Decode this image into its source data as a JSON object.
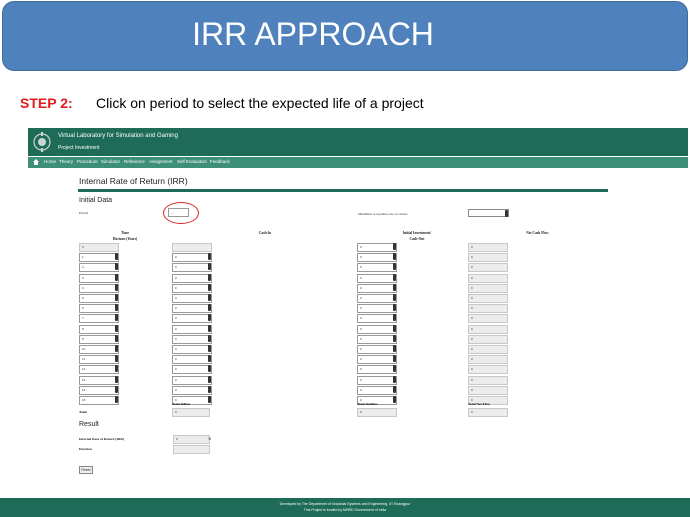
{
  "slide": {
    "title": "IRR APPROACH",
    "step_label": "STEP 2:",
    "step_text": "Click on period to select the expected life of a project"
  },
  "app": {
    "title": "Virtual Laboratory for Simulation and Gaming",
    "subtitle": "Project Investment"
  },
  "nav": {
    "home_icon": "home-icon",
    "items": [
      "Home",
      "Theory",
      "Procedure",
      "Simulator",
      "Reference",
      "Assignment",
      "Self Evaluation",
      "Feedback"
    ]
  },
  "page": {
    "heading": "Internal Rate of Return (IRR)",
    "initial_data": "Initial Data",
    "period_label": "Period",
    "period_value": "- -",
    "min_rate_label": "Minimum acceptable rate of return:",
    "columns": {
      "time": "Time",
      "horizon": "Horizon (Years)",
      "cash_in": "Cash-In",
      "initial_investment": "Initial Investment/",
      "cash_out": "Cash-Out",
      "net_cash_flow": "Net Cash Flow"
    },
    "rows": [
      {
        "year": "0",
        "cash_in": "",
        "cash_out": "0",
        "net": "0"
      },
      {
        "year": "1",
        "cash_in": "0",
        "cash_out": "0",
        "net": "0"
      },
      {
        "year": "2",
        "cash_in": "0",
        "cash_out": "0",
        "net": "0"
      },
      {
        "year": "3",
        "cash_in": "0",
        "cash_out": "0",
        "net": "0"
      },
      {
        "year": "4",
        "cash_in": "0",
        "cash_out": "0",
        "net": "0"
      },
      {
        "year": "5",
        "cash_in": "0",
        "cash_out": "0",
        "net": "0"
      },
      {
        "year": "6",
        "cash_in": "0",
        "cash_out": "0",
        "net": "0"
      },
      {
        "year": "7",
        "cash_in": "0",
        "cash_out": "0",
        "net": "0"
      },
      {
        "year": "8",
        "cash_in": "0",
        "cash_out": "0",
        "net": "0"
      },
      {
        "year": "9",
        "cash_in": "0",
        "cash_out": "0",
        "net": "0"
      },
      {
        "year": "10",
        "cash_in": "0",
        "cash_out": "0",
        "net": "0"
      },
      {
        "year": "11",
        "cash_in": "0",
        "cash_out": "0",
        "net": "0"
      },
      {
        "year": "12",
        "cash_in": "0",
        "cash_out": "0",
        "net": "0"
      },
      {
        "year": "13",
        "cash_in": "0",
        "cash_out": "0",
        "net": "0"
      },
      {
        "year": "14",
        "cash_in": "0",
        "cash_out": "0",
        "net": "0"
      },
      {
        "year": "15",
        "cash_in": "0",
        "cash_out": "0",
        "net": "0"
      }
    ],
    "totals": {
      "label": "Total",
      "inflow_label": "Total Inflow",
      "outflow_label": "Total Outflow",
      "net_label": "Total Net Flow",
      "inflow": "0",
      "outflow": "0",
      "net": "0"
    },
    "result": {
      "heading": "Result",
      "irr_label": "Internal Rate of Return (IRR)",
      "irr_value": "0",
      "irr_unit": "%",
      "decision_label": "Decision",
      "decision_value": ""
    },
    "reset_label": "Reset"
  },
  "footer": {
    "line1": "Developed by The Department of Industrial Systems and Engineering, IIT Kharagpur",
    "line2": "This Project is funded by MHRD Government of India"
  },
  "colors": {
    "banner": "#4f81bd",
    "app_header": "#1e6b57",
    "navbar": "#3d8f78",
    "step_label": "#e31b1b",
    "highlight_circle": "#d62828"
  }
}
